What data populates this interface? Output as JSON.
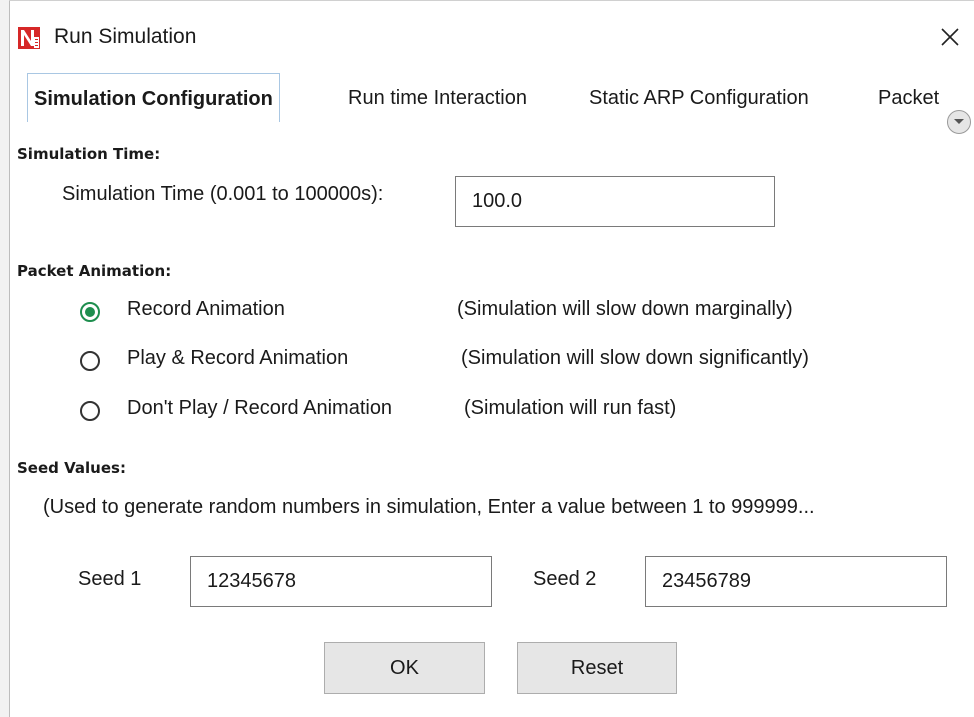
{
  "window": {
    "title": "Run Simulation"
  },
  "tabs": [
    {
      "label": "Simulation Configuration",
      "active": true
    },
    {
      "label": "Run time Interaction",
      "active": false
    },
    {
      "label": "Static ARP Configuration",
      "active": false
    },
    {
      "label": "Packet",
      "active": false
    }
  ],
  "simulation_time": {
    "section_label": "Simulation Time:",
    "field_label": "Simulation Time (0.001 to 100000s):",
    "value": "100.0"
  },
  "packet_animation": {
    "section_label": "Packet Animation:",
    "options": [
      {
        "label": "Record Animation",
        "note": "(Simulation will slow down marginally)",
        "selected": true
      },
      {
        "label": "Play & Record Animation",
        "note": "(Simulation will slow down significantly)",
        "selected": false
      },
      {
        "label": "Don't Play / Record Animation",
        "note": "(Simulation will run fast)",
        "selected": false
      }
    ]
  },
  "seed_values": {
    "section_label": "Seed Values:",
    "description": "(Used to generate random numbers in simulation, Enter a value between 1 to 999999...",
    "seed1_label": "Seed 1",
    "seed1_value": "12345678",
    "seed2_label": "Seed 2",
    "seed2_value": "23456789"
  },
  "buttons": {
    "ok_label": "OK",
    "reset_label": "Reset"
  },
  "colors": {
    "radio_selected": "#1e8e4e",
    "tab_border": "#a9c7e3",
    "button_bg": "#e6e6e6",
    "logo_red": "#d62828"
  },
  "icons": {
    "app": "netsim-logo-icon",
    "close": "close-icon",
    "tab_scroll": "chevron-down-icon"
  }
}
